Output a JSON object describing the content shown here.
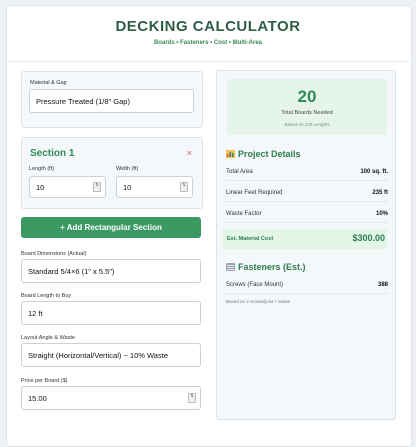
{
  "header": {
    "title": "DECKING CALCULATOR",
    "subtitle": "Boards • Fasteners • Cost • Multi-Area"
  },
  "material": {
    "label": "Material & Gap",
    "value": "Pressure Treated (1/8\" Gap)"
  },
  "section": {
    "title": "Section 1",
    "remove_symbol": "×",
    "length_label": "Length (ft)",
    "length_value": "10",
    "width_label": "Width (ft)",
    "width_value": "10"
  },
  "add_button": "+ Add Rectangular Section",
  "board_dimensions": {
    "label": "Board Dimensions (Actual)",
    "value": "Standard 5/4×6 (1\" x 5.5\")"
  },
  "board_length": {
    "label": "Board Length to Buy",
    "value": "12 ft"
  },
  "layout": {
    "label": "Layout Angle & Waste",
    "value": "Straight (Horizontal/Vertical) ~ 10% Waste"
  },
  "price": {
    "label": "Price per Board ($)",
    "value": "15.00"
  },
  "result": {
    "count": "20",
    "label": "Total Boards Needed",
    "sub": "Based on 12ft Lengths"
  },
  "project_details": {
    "heading": "Project Details",
    "total_area_label": "Total Area",
    "total_area_value": "100 sq. ft.",
    "linear_feet_label": "Linear Feet Required",
    "linear_feet_value": "235 ft",
    "waste_label": "Waste Factor",
    "waste_value": "10%",
    "cost_label": "Est. Material Cost",
    "cost_value": "$300.00"
  },
  "fasteners": {
    "heading": "Fasteners (Est.)",
    "screws_label": "Screws (Face Mount)",
    "screws_value": "388",
    "note": "Based on 2 screws/joist + waste"
  },
  "colors": {
    "accent": "#2e8b57",
    "button": "#3a9a62",
    "remove": "#d9534f"
  }
}
